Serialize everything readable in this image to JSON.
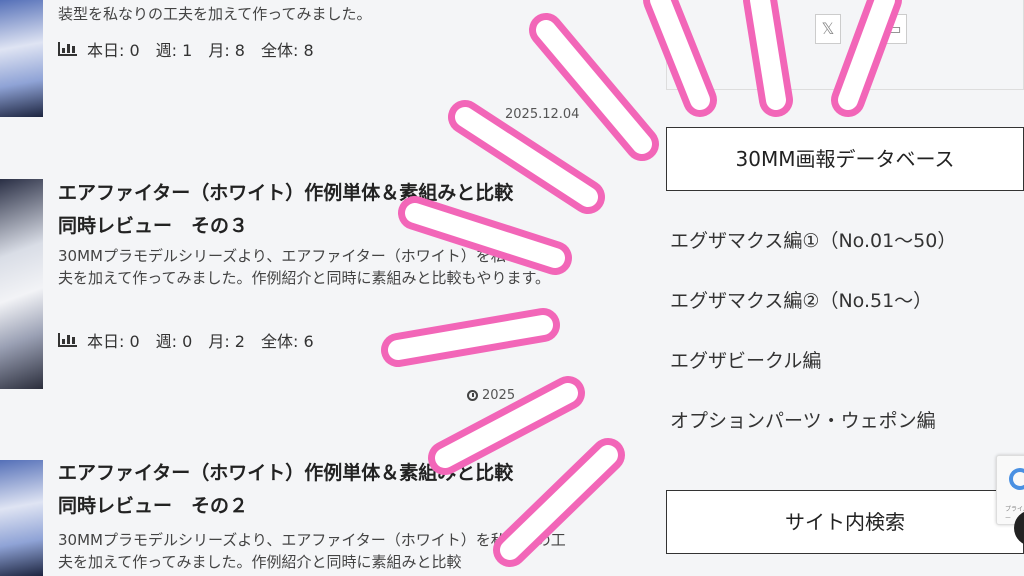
{
  "entries": [
    {
      "excerpt": "装型を私なりの工夫を加えて作ってみました。",
      "stats": "本日: 0　週: 1　月: 8　全体: 8"
    },
    {
      "date": "2025.12.04",
      "title_line1": "エアファイター（ホワイト）作例単体＆素組みと比較",
      "title_line2": "同時レビュー　その３",
      "excerpt": "30MMプラモデルシリーズより、エアファイター（ホワイト）を私なりの工夫を加えて作ってみました。作例紹介と同時に素組みと比較もやります。",
      "stats": "本日: 0　週: 0　月: 2　全体: 6"
    },
    {
      "date": "2025",
      "title_line1": "エアファイター（ホワイト）作例単体＆素組みと比較",
      "title_line2": "同時レビュー　その２",
      "excerpt": "30MMプラモデルシリーズより、エアファイター（ホワイト）を私なりの工夫を加えて作ってみました。作例紹介と同時に素組みと比較"
    }
  ],
  "sidebar": {
    "share_x": "𝕏",
    "widget1_title": "30MM画報データベース",
    "links": [
      "エグザマクス編①（No.01～50）",
      "エグザマクス編②（No.51～）",
      "エグザビークル編",
      "オプションパーツ・ウェポン編"
    ],
    "widget2_title": "サイト内検索"
  },
  "recaptcha_text": "プライバシー",
  "colors": {
    "burst": "#f266b8",
    "background": "#f4f5f7"
  }
}
